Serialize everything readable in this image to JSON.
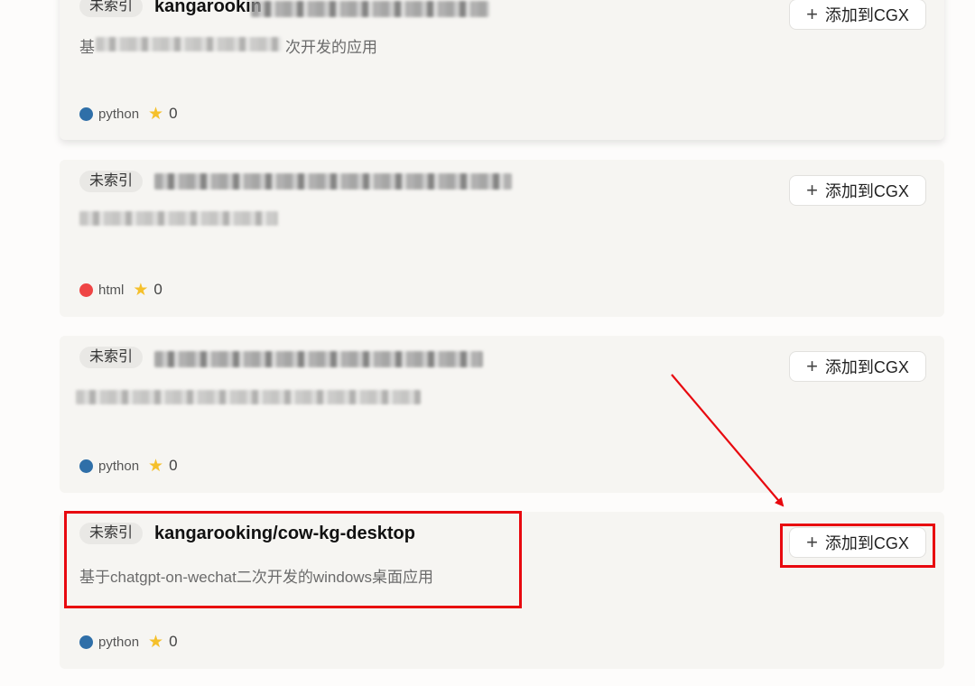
{
  "repos": [
    {
      "badge": "未索引",
      "name_visible": "kangarookin",
      "desc_prefix": "基",
      "desc_suffix": "次开发的应用",
      "language": "python",
      "language_color": "#2f6fa8",
      "stars": "0",
      "add_label": "添加到CGX"
    },
    {
      "badge": "未索引",
      "language": "html",
      "language_color": "#ef4545",
      "stars": "0",
      "add_label": "添加到CGX"
    },
    {
      "badge": "未索引",
      "language": "python",
      "language_color": "#2f6fa8",
      "stars": "0",
      "add_label": "添加到CGX"
    },
    {
      "badge": "未索引",
      "name": "kangarooking/cow-kg-desktop",
      "description": "基于chatgpt-on-wechat二次开发的windows桌面应用",
      "language": "python",
      "language_color": "#2f6fa8",
      "stars": "0",
      "add_label": "添加到CGX"
    }
  ],
  "plus_symbol": "+",
  "star_icon": "star-icon",
  "annotation_color": "#e8090f"
}
